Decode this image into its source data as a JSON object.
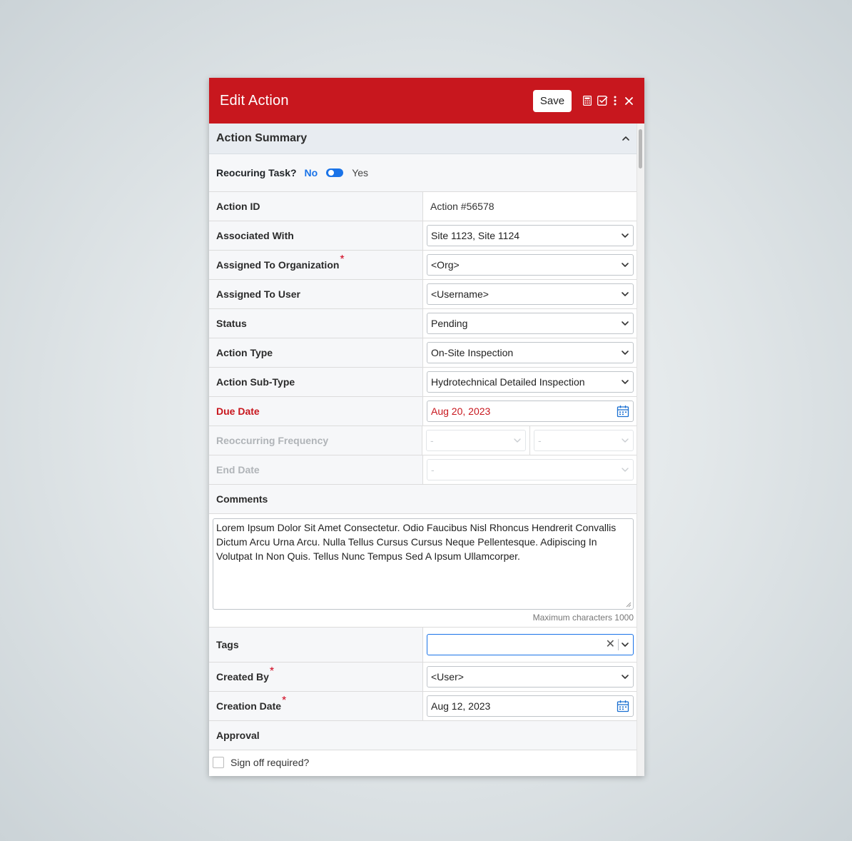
{
  "dialog": {
    "title": "Edit Action",
    "save_label": "Save",
    "icons": [
      "calculator-icon",
      "checklist-icon",
      "more-vertical-icon",
      "close-icon"
    ]
  },
  "section": {
    "title": "Action Summary",
    "toggle_icon": "chevron-up-icon"
  },
  "recurring": {
    "label": "Reocuring Task?",
    "no": "No",
    "yes": "Yes",
    "value": "No"
  },
  "fields": {
    "action_id": {
      "label": "Action ID",
      "value": "Action #56578"
    },
    "associated_with": {
      "label": "Associated With",
      "value": "Site 1123, Site 1124"
    },
    "assigned_org": {
      "label": "Assigned To Organization",
      "required": "*",
      "value": "<Org>"
    },
    "assigned_user": {
      "label": "Assigned To User",
      "value": "<Username>"
    },
    "status": {
      "label": "Status",
      "value": "Pending"
    },
    "action_type": {
      "label": "Action Type",
      "value": "On-Site Inspection"
    },
    "action_subtype": {
      "label": "Action Sub-Type",
      "value": "Hydrotechnical Detailed Inspection"
    },
    "due_date": {
      "label": "Due Date",
      "value": "Aug 20, 2023"
    },
    "reoccurring_frequency": {
      "label": "Reoccurring Frequency",
      "value1": "-",
      "value2": "-"
    },
    "end_date": {
      "label": "End Date",
      "value": "-"
    }
  },
  "comments": {
    "label": "Comments",
    "value": "Lorem Ipsum Dolor Sit Amet Consectetur. Odio Faucibus Nisl Rhoncus Hendrerit Convallis Dictum Arcu Urna Arcu. Nulla Tellus Cursus Cursus Neque Pellentesque. Adipiscing In Volutpat In Non Quis. Tellus Nunc Tempus Sed A Ipsum Ullamcorper.",
    "max_chars": "Maximum characters 1000"
  },
  "tags": {
    "label": "Tags",
    "value": ""
  },
  "created_by": {
    "label": "Created By",
    "required": "*",
    "value": "<User>"
  },
  "creation_date": {
    "label": "Creation Date",
    "required": "*",
    "value": "Aug 12, 2023"
  },
  "approval": {
    "label": "Approval",
    "signoff_label": "Sign off required?",
    "signoff_checked": false
  },
  "colors": {
    "header": "#c8171e",
    "accent": "#1a73e8",
    "due_date": "#c8171e"
  }
}
